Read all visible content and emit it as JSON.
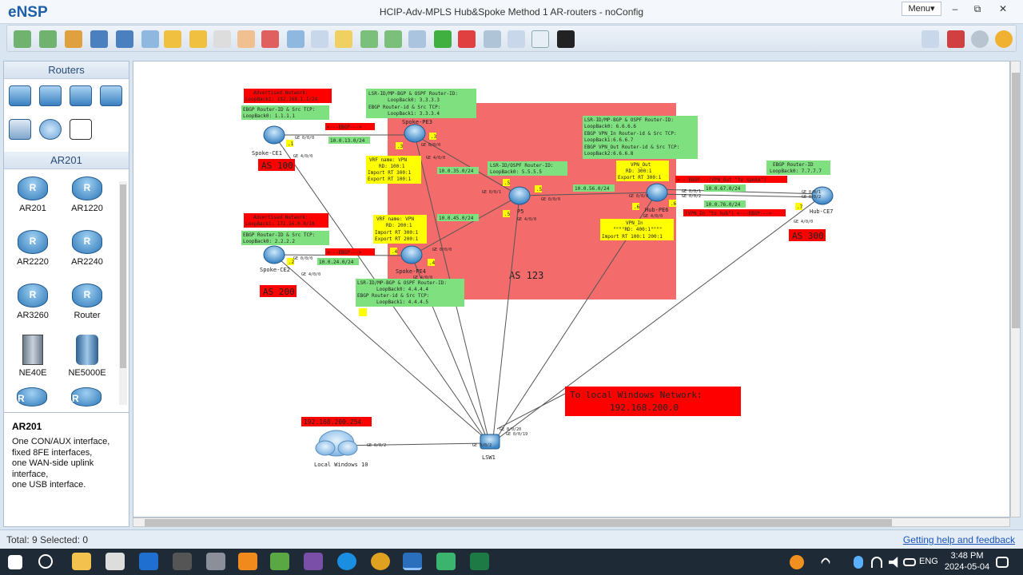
{
  "app": {
    "logo": "eNSP",
    "title": "HCIP-Adv-MPLS Hub&Spoke Method 1 AR-routers - noConfig",
    "menu_label": "Menu▾"
  },
  "window_controls": [
    "–",
    "⧉",
    "✕"
  ],
  "sidebar": {
    "routers_header": "Routers",
    "ar201_header": "AR201",
    "devices": [
      {
        "label": "AR201"
      },
      {
        "label": "AR1220"
      },
      {
        "label": "AR2220"
      },
      {
        "label": "AR2240"
      },
      {
        "label": "AR3260"
      },
      {
        "label": "Router"
      },
      {
        "label": "NE40E"
      },
      {
        "label": "NE5000E"
      }
    ]
  },
  "info": {
    "title": "AR201",
    "lines": [
      "One CON/AUX interface,",
      "fixed 8FE interfaces,",
      "one WAN-side uplink",
      "interface,",
      "one USB interface."
    ]
  },
  "topology": {
    "as123_label": "AS 123",
    "as100": "AS 100",
    "as200": "AS 200",
    "as300": "AS 300",
    "nodes": {
      "spoke_ce1": "Spoke-CE1",
      "spoke_pe3": "Spoke-PE3",
      "spoke_ce2": "Spoke-CE2",
      "spoke_pe4": "Spoke-PE4",
      "p5": "P5",
      "hub_pe6": "Hub-PE6",
      "hub_ce7": "Hub-CE7",
      "lsw1": "LSW1",
      "cloud": "Local Windows 10"
    },
    "notes": {
      "ce1_adv": [
        "Advertised Network:",
        "LoopBack1: 192.168.1.1/24"
      ],
      "ce1_ebgp": [
        "EBGP Router-ID & Src TCP:",
        "LoopBack0: 1.1.1.1"
      ],
      "pe3_ids": [
        "LSR-ID/MP-BGP & OSPF Router-ID:",
        "LoopBack0: 3.3.3.3",
        "EBGP Router-id & Src TCP:",
        "LoopBack1: 3.3.3.4"
      ],
      "pe3_vrf": [
        "VRF name: VPN",
        "RD: 100:1",
        "Import RT 300:1",
        "Export RT 100:1"
      ],
      "p5_ids": [
        "LSR-ID/OSPF Router-ID:",
        "LoopBack0: 5.5.5.5"
      ],
      "pe6_ids": [
        "LSR-ID/MP-BGP & OSPF Router-ID:",
        "LoopBack0: 6.6.6.6",
        "EBGP VPN_In Router-id & Src TCP:",
        "LoopBack1:6.6.6.7",
        "EBGP VPN_Out Router-id & Src TCP:",
        "LoopBack2:6.6.6.8"
      ],
      "vpn_out": [
        "VPN_Out",
        "RD: 300:1",
        "Export RT 300:1"
      ],
      "vpn_in": [
        "VPN_In",
        "\"\"\"\"RD: 400:1\"\"\"\"",
        "Import RT 100:1 200:1"
      ],
      "ce7_ebgp": [
        "EBGP Router-ID",
        "LoopBack0: 7.7.7.7"
      ],
      "ce2_adv": [
        "Advertised Network:",
        "LoopBack1: 172.16.0.0/16"
      ],
      "ce2_ebgp": [
        "EBGP Router-ID & Src TCP:",
        "LoopBack0: 2.2.2.2"
      ],
      "pe4_vrf": [
        "VRF name: VPN",
        "RD: 200:1",
        "Import RT 300:1",
        "Export RT 200:1"
      ],
      "pe4_ids": [
        "LSR-ID/MP-BGP & OSPF Router-ID:",
        "LoopBack0: 4.4.4.4",
        "EBGP Router-id & Src TCP:",
        "LoopBack1: 4.4.4.5"
      ],
      "ebgp_13": "<---EBGP--->",
      "ebgp_24": "<---EBGP--->",
      "ebgp_out": "<---EBGP---(VPN_Out \"to spoke\")",
      "ebgp_in": "(VPN_In \"to hub\") <---EBGP--->",
      "lan_ip": "192.168.200.254",
      "to_windows": [
        "To local Windows Network:",
        "192.168.200.0"
      ]
    },
    "nets": {
      "n13": "10.0.13.0/24",
      "n35": "10.0.35.0/24",
      "n45": "10.0.45.0/24",
      "n24": "10.0.24.0/24",
      "n56": "10.0.56.0/24",
      "n67": "10.0.67.0/24",
      "n76": "10.0.76.0/24"
    },
    "ports": {
      "g000": "GE 0/0/0",
      "g001": "GE 0/0/1",
      "g002": "GE 0/0/2",
      "g400": "GE 4/0/0",
      "lsw_ports": "GE 0/0/20",
      "lsw_p19": "GE 0/0/19"
    },
    "hosts": {
      ".1": ".1",
      ".2": ".2",
      ".3": ".3",
      ".4": ".4",
      ".5": ".5",
      ".6": ".6",
      ".7": ".7"
    }
  },
  "status": {
    "left": "Total: 9  Selected: 0",
    "help": "Getting help and feedback"
  },
  "taskbar": {
    "lang": "ENG",
    "time": "3:48 PM",
    "date": "2024-05-04"
  },
  "colors": {
    "red_box": "#ff0000",
    "green_box": "#7fe07f",
    "yellow_box": "#ffff00",
    "as_area": "#f36b6b"
  }
}
